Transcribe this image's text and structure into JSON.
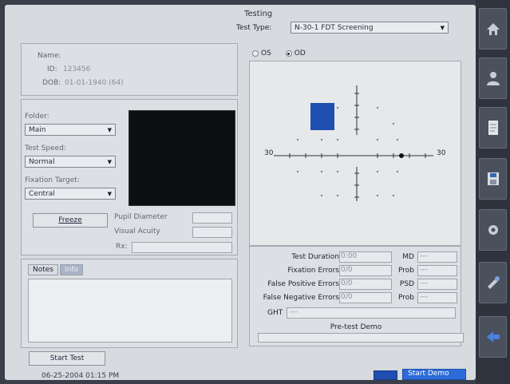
{
  "header": {
    "title": "Testing",
    "test_type_label": "Test Type:",
    "test_type_value": "N-30-1 FDT Screening"
  },
  "patient": {
    "name_label": "Name:",
    "name_value": "",
    "id_label": "ID:",
    "id_value": "123456",
    "dob_label": "DOB:",
    "dob_value": "01-01-1940 (64)"
  },
  "settings": {
    "folder_label": "Folder:",
    "folder_value": "Main",
    "speed_label": "Test Speed:",
    "speed_value": "Normal",
    "fixation_label": "Fixation Target:",
    "fixation_value": "Central",
    "freeze_label": "Freeze",
    "pupil_label": "Pupil Diameter",
    "pupil_value": "",
    "acuity_label": "Visual Acuity",
    "acuity_value": "",
    "rx_label": "Rx:",
    "rx_value": ""
  },
  "notes": {
    "tab_notes": "Notes",
    "tab_info": "Info",
    "text": ""
  },
  "eye": {
    "os_label": "OS",
    "od_label": "OD",
    "selected": "OD"
  },
  "field_plot": {
    "left_label": "30",
    "right_label": "30"
  },
  "stats": {
    "duration_label": "Test Duration",
    "duration_value": "0:00",
    "fixation_label": "Fixation Errors",
    "fixation_value": "0/0",
    "fp_label": "False Positive Errors",
    "fp_value": "0/0",
    "fn_label": "False Negative Errors",
    "fn_value": "0/0",
    "ght_label": "GHT",
    "ght_value": "---",
    "md_label": "MD",
    "md_value": "---",
    "prob1_label": "Prob",
    "prob1_value": "---",
    "psd_label": "PSD",
    "psd_value": "---",
    "prob2_label": "Prob",
    "prob2_value": "---",
    "progress_label": "Pre-test Demo"
  },
  "footer": {
    "start_test": "Start Test",
    "datetime": "06-25-2004 01:15 PM",
    "start_demo": "Start Demo"
  },
  "sidebar_icons": [
    "home-icon",
    "patient-icon",
    "report-icon",
    "save-icon",
    "settings-icon",
    "tools-icon",
    "back-icon"
  ],
  "colors": {
    "accent": "#1f4fb0",
    "sidebar": "#2f333d"
  }
}
